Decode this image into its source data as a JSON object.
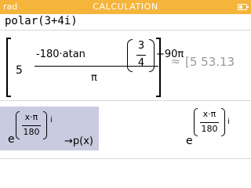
{
  "statusbar": {
    "mode": "rad",
    "title": "CALCULATION",
    "accent": "#f5b43a"
  },
  "history": [
    {
      "input": "polar(3+4i)",
      "exact": {
        "coefficient": "5",
        "numerator_left": "-180·atan",
        "small_num": "3",
        "small_den": "4",
        "numerator_right": "+90π",
        "denominator": "π"
      },
      "approx_symbol": "≈",
      "approx_result": "[5 53.13"
    },
    {
      "input": {
        "base": "e",
        "frac_num": "x·π",
        "frac_den": "180",
        "exp_i": "i",
        "suffix": "p(x)",
        "arrow": "→"
      },
      "output": {
        "base": "e",
        "frac_num": "x·π",
        "frac_den": "180",
        "exp_i": "i"
      }
    }
  ]
}
